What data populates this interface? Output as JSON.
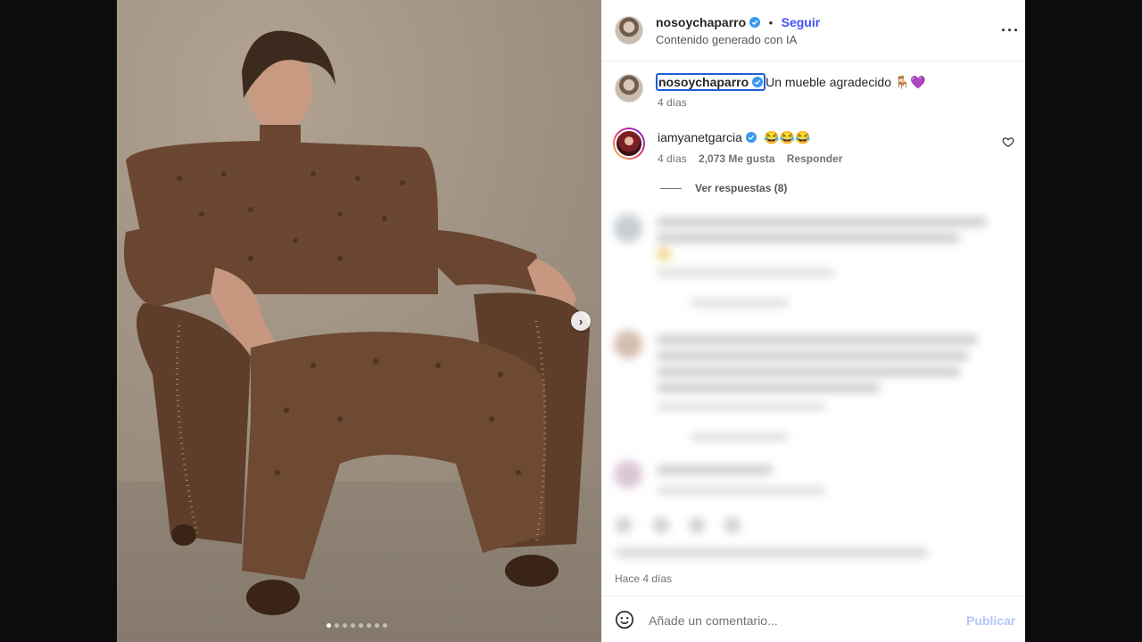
{
  "post": {
    "image_alt": "",
    "carousel": {
      "total": 8,
      "active": 1,
      "next_glyph": "›"
    }
  },
  "header": {
    "username": "nosoychaparro",
    "separator": "•",
    "follow_label": "Seguir",
    "subtitle": "Contenido generado con IA",
    "more_glyph": "···"
  },
  "caption": {
    "username": "nosoychaparro",
    "text": "Un mueble agradecido 🪑💜",
    "time": "4 días"
  },
  "comments": [
    {
      "username": "iamyanetgarcia",
      "text": "😂😂😂",
      "time": "4 días",
      "likes": "2,073 Me gusta",
      "reply_label": "Responder",
      "replies_label": "Ver respuestas (8)"
    }
  ],
  "footer": {
    "timestamp": "Hace 4 días",
    "comment_placeholder": "Añade un comentario...",
    "publish_label": "Publicar"
  },
  "colors": {
    "accent": "#4150f7",
    "verified": "#3897f0",
    "publish_disabled": "#b3c4f8",
    "armchair": "#6e4a33"
  },
  "icons": [
    "verified-icon",
    "more-icon",
    "heart-icon",
    "emoji-icon",
    "chevron-right-icon"
  ]
}
